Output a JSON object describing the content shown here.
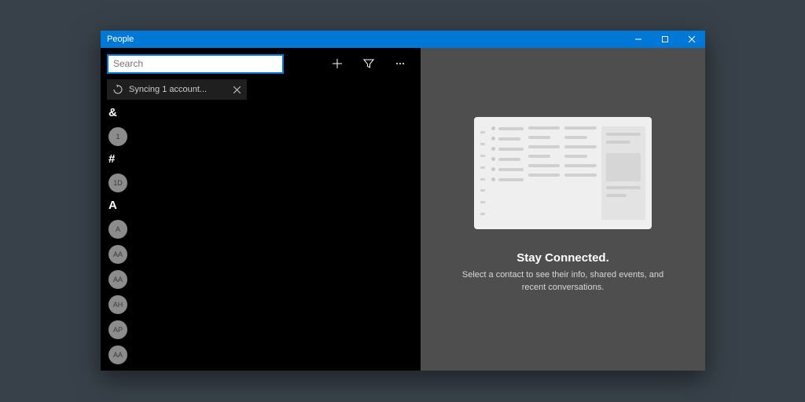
{
  "window": {
    "title": "People"
  },
  "toolbar": {
    "search_placeholder": "Search"
  },
  "status": {
    "text": "Syncing 1 account..."
  },
  "list": {
    "sections": [
      {
        "header": "&",
        "items": [
          {
            "initials": "1"
          }
        ]
      },
      {
        "header": "#",
        "items": [
          {
            "initials": "1D"
          }
        ]
      },
      {
        "header": "A",
        "items": [
          {
            "initials": "A"
          },
          {
            "initials": "AA"
          },
          {
            "initials": "AA"
          },
          {
            "initials": "AH"
          },
          {
            "initials": "AP"
          },
          {
            "initials": "AA"
          }
        ]
      }
    ]
  },
  "placeholder": {
    "title": "Stay Connected.",
    "subtitle": "Select a contact to see their info, shared events, and recent conversations."
  }
}
